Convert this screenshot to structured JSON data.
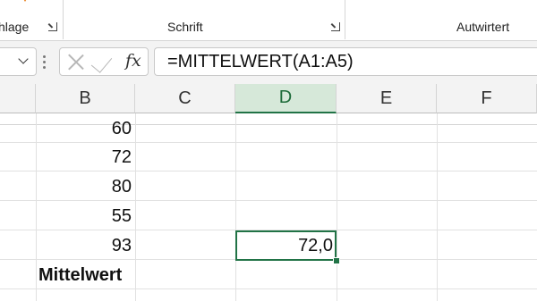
{
  "ribbon": {
    "groups": [
      {
        "label": "hlage"
      },
      {
        "label": "Schrift"
      },
      {
        "label": "Autwirtert"
      }
    ]
  },
  "formula_bar": {
    "formula": "=MITTELWERT(A1:A5)",
    "fx_label": "fx"
  },
  "columns": [
    "B",
    "C",
    "D",
    "E",
    "F"
  ],
  "selected_column": "D",
  "rows": [
    {
      "B": "60",
      "D": ""
    },
    {
      "B": "72",
      "D": ""
    },
    {
      "B": "80",
      "D": ""
    },
    {
      "B": "55",
      "D": ""
    },
    {
      "B": "93",
      "D": "72,0"
    },
    {
      "B": "Mittelwert",
      "D": ""
    }
  ],
  "colors": {
    "accent": "#217346",
    "selected_header_bg": "#d6e8d9"
  }
}
